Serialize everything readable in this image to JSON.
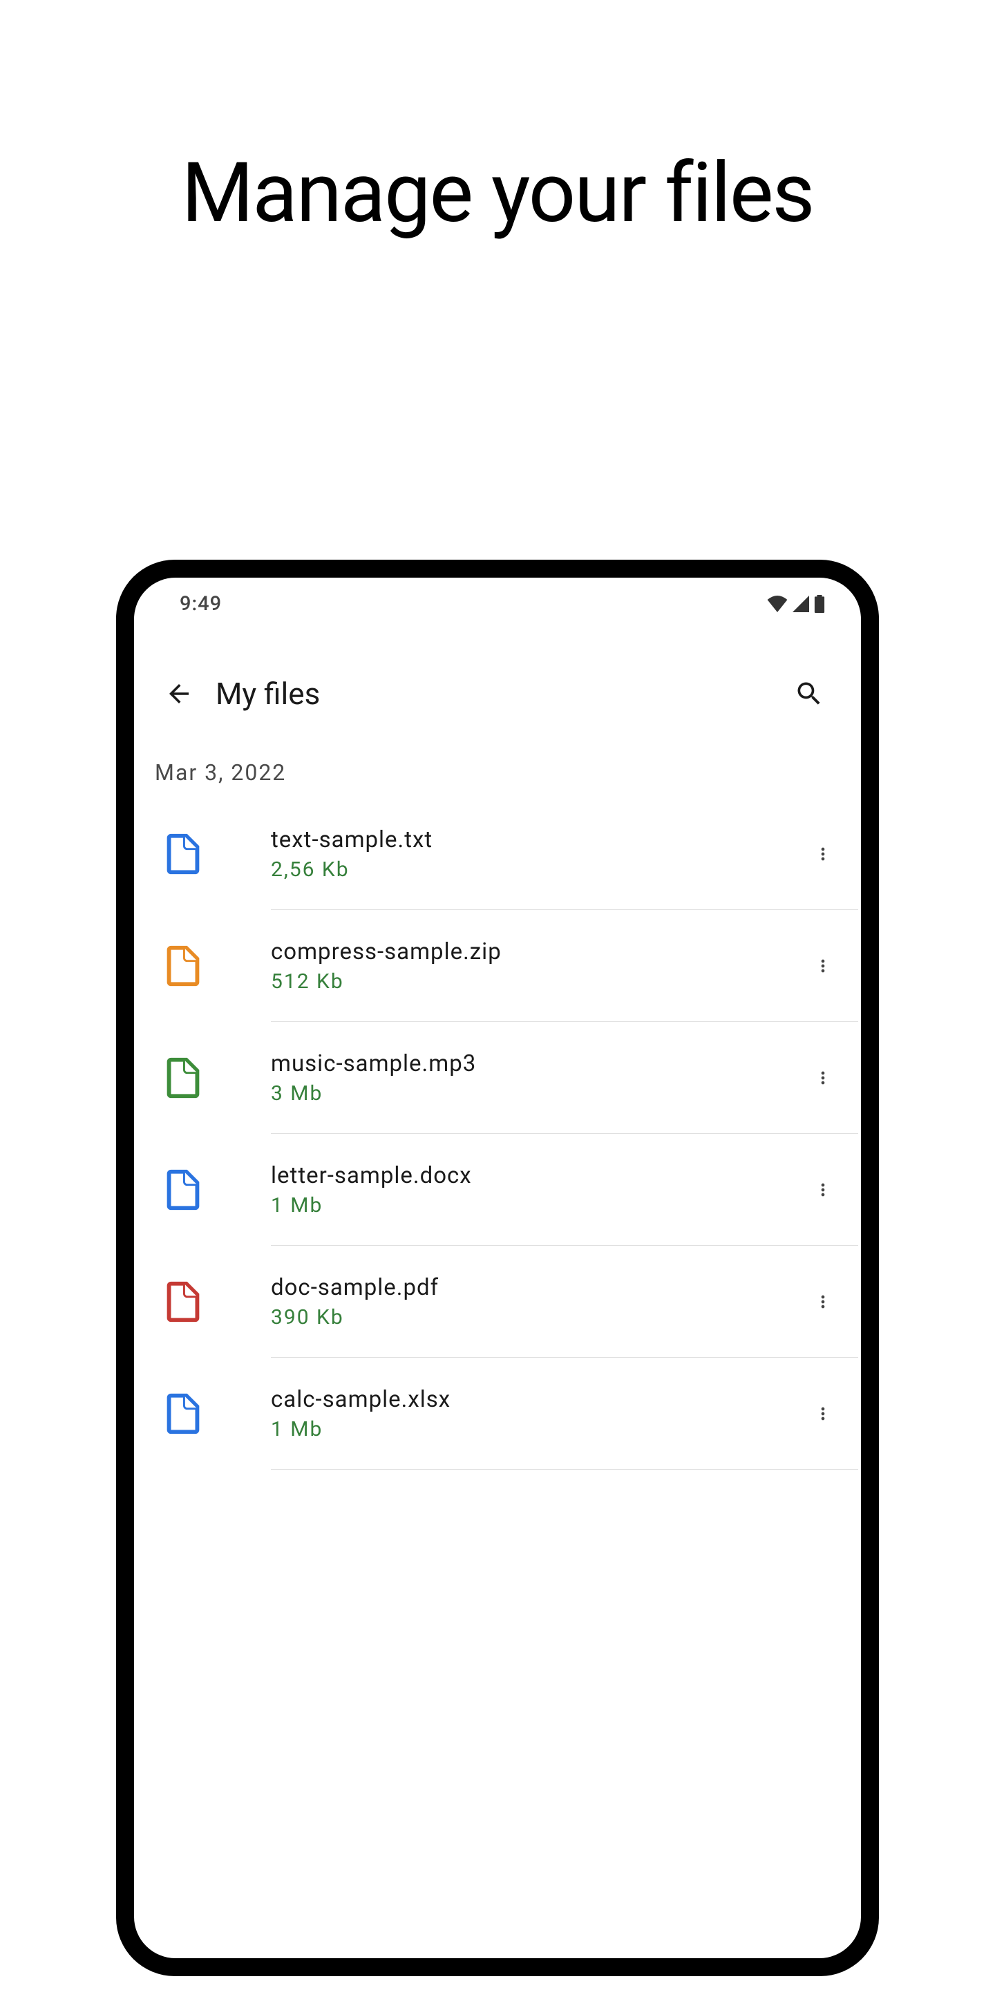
{
  "marketing": {
    "title": "Manage your files"
  },
  "status": {
    "time": "9:49"
  },
  "header": {
    "title": "My files"
  },
  "date_label": "Mar 3, 2022",
  "files": [
    {
      "name": "text-sample.txt",
      "size": "2,56 Kb",
      "color": "#2a73e0"
    },
    {
      "name": "compress-sample.zip",
      "size": "512 Kb",
      "color": "#e88b24"
    },
    {
      "name": "music-sample.mp3",
      "size": "3 Mb",
      "color": "#3d8d3a"
    },
    {
      "name": "letter-sample.docx",
      "size": "1 Mb",
      "color": "#2a73e0"
    },
    {
      "name": "doc-sample.pdf",
      "size": "390 Kb",
      "color": "#c53a34"
    },
    {
      "name": "calc-sample.xlsx",
      "size": "1 Mb",
      "color": "#2a73e0"
    }
  ]
}
